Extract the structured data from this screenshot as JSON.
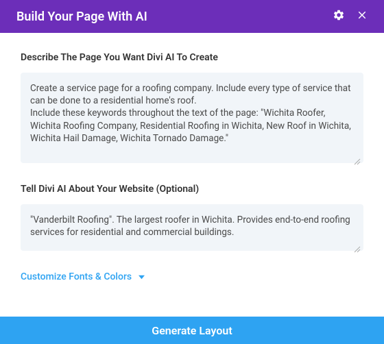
{
  "header": {
    "title": "Build Your Page With AI"
  },
  "form": {
    "describe_label": "Describe The Page You Want Divi AI To Create",
    "describe_value": "Create a service page for a roofing company. Include every type of service that can be done to a residential home's roof.\nInclude these keywords throughout the text of the page: \"Wichita Roofer, Wichita Roofing Company, Residential Roofing in Wichita, New Roof in Wichita, Wichita Hail Damage, Wichita Tornado Damage.\"",
    "about_label": "Tell Divi AI About Your Website (Optional)",
    "about_value": "\"Vanderbilt Roofing\". The largest roofer in Wichita. Provides end-to-end roofing services for residential and commercial buildings."
  },
  "links": {
    "customize_label": "Customize Fonts & Colors"
  },
  "footer": {
    "generate_label": "Generate Layout"
  }
}
